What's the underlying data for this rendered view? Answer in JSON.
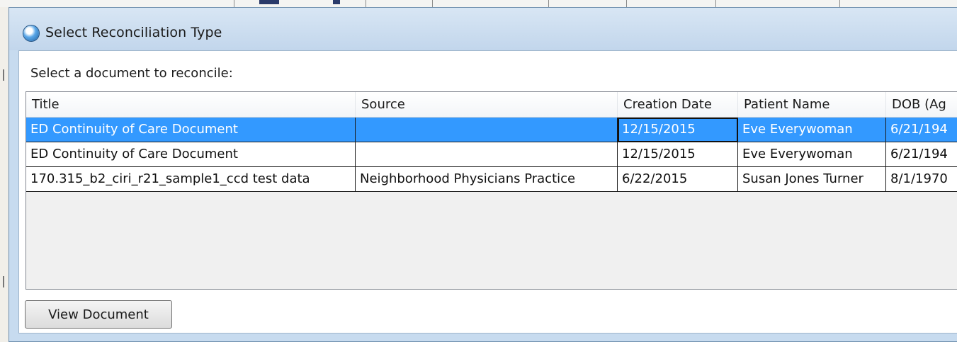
{
  "window": {
    "title": "Select Reconciliation Type",
    "icon": "app-globe-icon"
  },
  "prompt": "Select a document to reconcile:",
  "table": {
    "columns": [
      "Title",
      "Source",
      "Creation Date",
      "Patient Name",
      "DOB (Ag"
    ],
    "rows": [
      {
        "cells": [
          "ED Continuity of Care Document",
          "",
          "12/15/2015",
          "Eve Everywoman",
          "6/21/194"
        ],
        "selected": true
      },
      {
        "cells": [
          "ED Continuity of Care Document",
          "",
          "12/15/2015",
          "Eve Everywoman",
          "6/21/194"
        ],
        "selected": false
      },
      {
        "cells": [
          "170.315_b2_ciri_r21_sample1_ccd test data",
          "Neighborhood Physicians Practice",
          "6/22/2015",
          "Susan Jones Turner",
          "8/1/1970"
        ],
        "selected": false
      }
    ]
  },
  "buttons": {
    "view_document": "View Document"
  },
  "colors": {
    "selection": "#3399ff",
    "title_bar": "#c7dbef"
  }
}
